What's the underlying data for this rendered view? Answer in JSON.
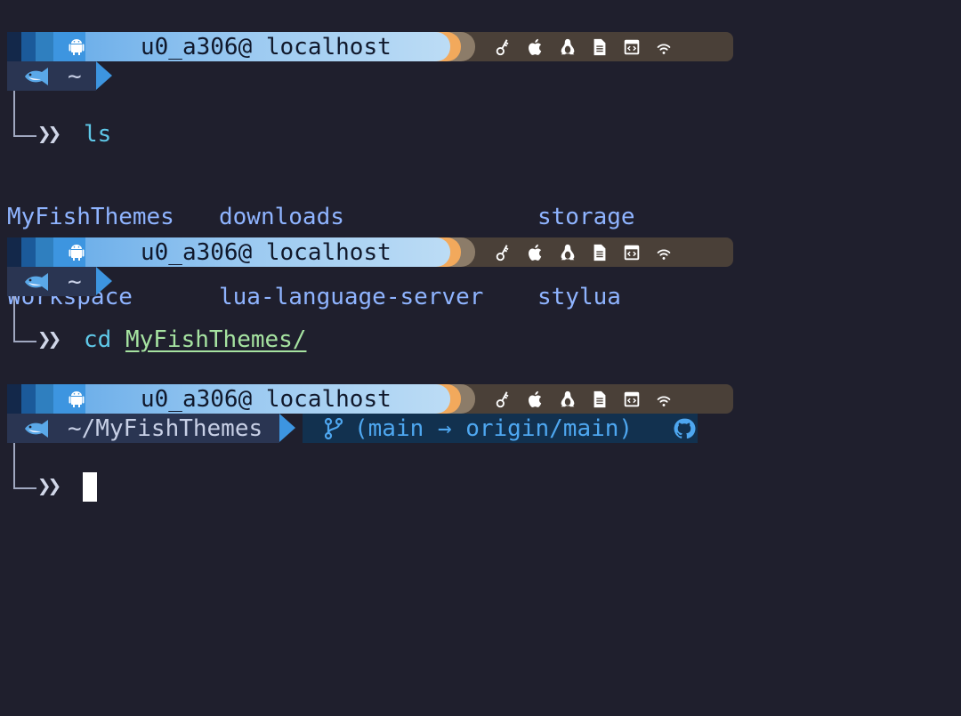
{
  "prompt_user_host": "u0_a306@ localhost",
  "status_icons": [
    "key-icon",
    "apple-icon",
    "linux-tux-icon",
    "document-icon",
    "code-window-icon",
    "wifi-icon"
  ],
  "blocks": [
    {
      "path": "~",
      "command": "ls",
      "argument": ""
    },
    {
      "path": "~",
      "command": "cd",
      "argument": "MyFishThemes/"
    },
    {
      "path": "~/MyFishThemes",
      "command": "",
      "argument": ""
    }
  ],
  "ls_output": {
    "col1": [
      "MyFishThemes",
      "Workspace"
    ],
    "col2": [
      "downloads",
      "lua-language-server"
    ],
    "col3": [
      "storage",
      "stylua"
    ]
  },
  "git": {
    "status": "(main → origin/main)"
  },
  "prompt_symbol": "❯❯",
  "colors": {
    "background": "#1f1f2d",
    "user_segment": "#9ccaf1",
    "accent_blue": "#3d95e0",
    "orange": "#f2a95c",
    "status_segment": "#4a4038",
    "command": "#5fc8e8",
    "argument": "#a6e3a1",
    "ls_output": "#8fb4ff"
  }
}
